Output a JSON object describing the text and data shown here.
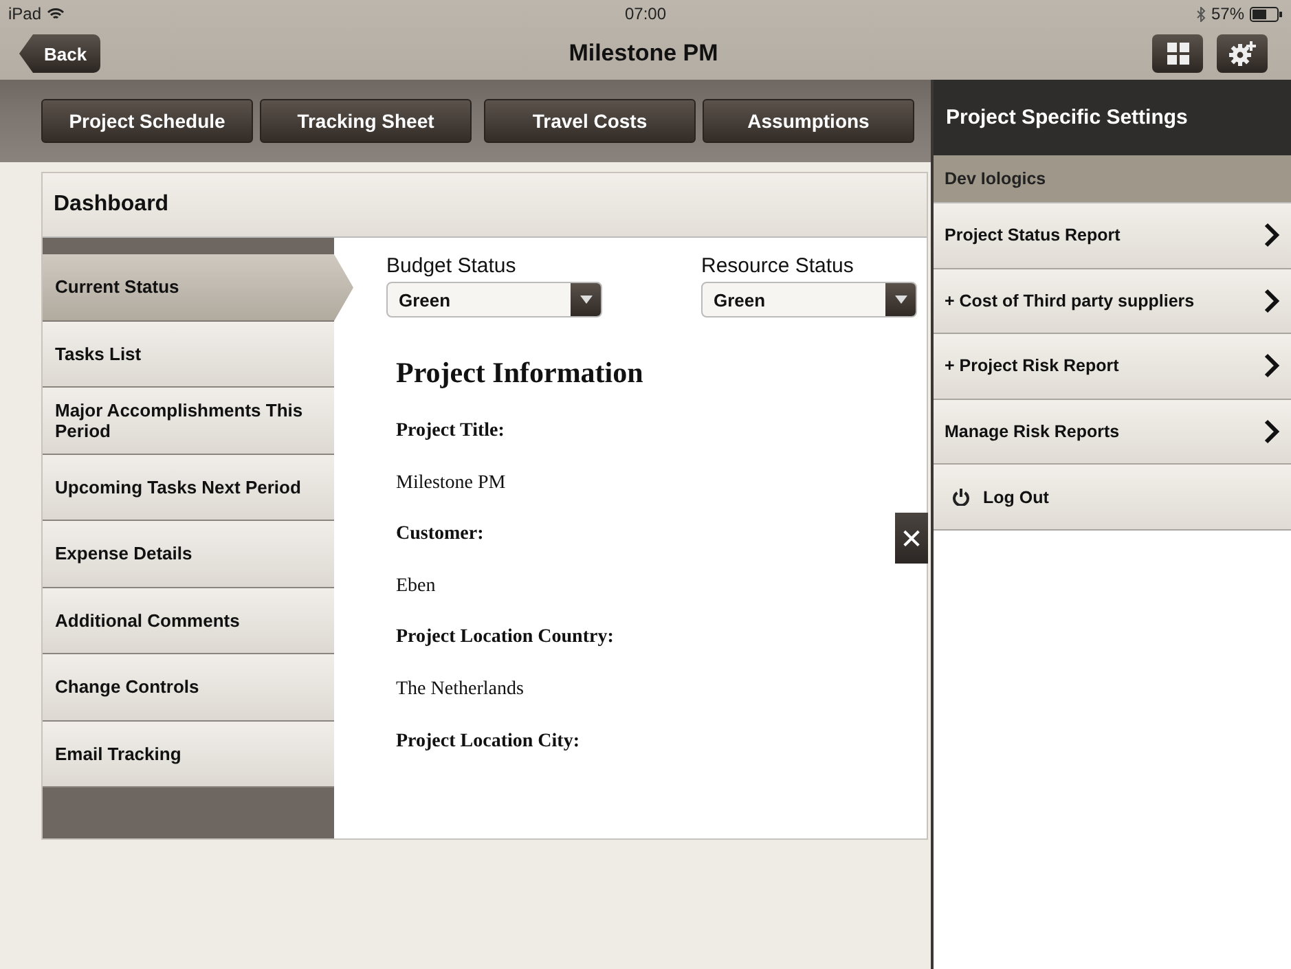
{
  "status_bar": {
    "device": "iPad",
    "time": "07:00",
    "battery": "57%"
  },
  "nav": {
    "back": "Back",
    "title": "Milestone PM"
  },
  "toolbar_buttons": [
    {
      "label": "Project Schedule"
    },
    {
      "label": "Tracking Sheet"
    },
    {
      "label": "Travel Costs"
    },
    {
      "label": "Assumptions"
    }
  ],
  "dashboard": {
    "title": "Dashboard",
    "menu": [
      {
        "label": "Current Status",
        "selected": true
      },
      {
        "label": "Tasks List",
        "selected": false
      },
      {
        "label": "Major Accomplishments This Period",
        "selected": false
      },
      {
        "label": "Upcoming Tasks Next Period",
        "selected": false
      },
      {
        "label": "Expense Details",
        "selected": false
      },
      {
        "label": "Additional Comments",
        "selected": false
      },
      {
        "label": "Change Controls",
        "selected": false
      },
      {
        "label": "Email Tracking",
        "selected": false
      }
    ],
    "selects": [
      {
        "label": "Budget Status",
        "value": "Green"
      },
      {
        "label": "Resource Status",
        "value": "Green"
      }
    ],
    "info_title": "Project Information",
    "fields": [
      {
        "label": "Project Title:",
        "value": "Milestone PM"
      },
      {
        "label": "Customer:",
        "value": "Eben"
      },
      {
        "label": "Project Location Country:",
        "value": "The Netherlands"
      },
      {
        "label": "Project Location City:"
      }
    ],
    "close": "✕"
  },
  "settings": {
    "title": "Project Specific Settings",
    "group": "Dev Iologics",
    "items": [
      {
        "label": "Project Status Report",
        "kind": "link"
      },
      {
        "label": "+ Cost of Third party suppliers",
        "kind": "link"
      },
      {
        "label": "+ Project Risk Report",
        "kind": "link"
      },
      {
        "label": "Manage Risk Reports",
        "kind": "link"
      },
      {
        "label": "Log Out",
        "kind": "logout"
      }
    ]
  }
}
